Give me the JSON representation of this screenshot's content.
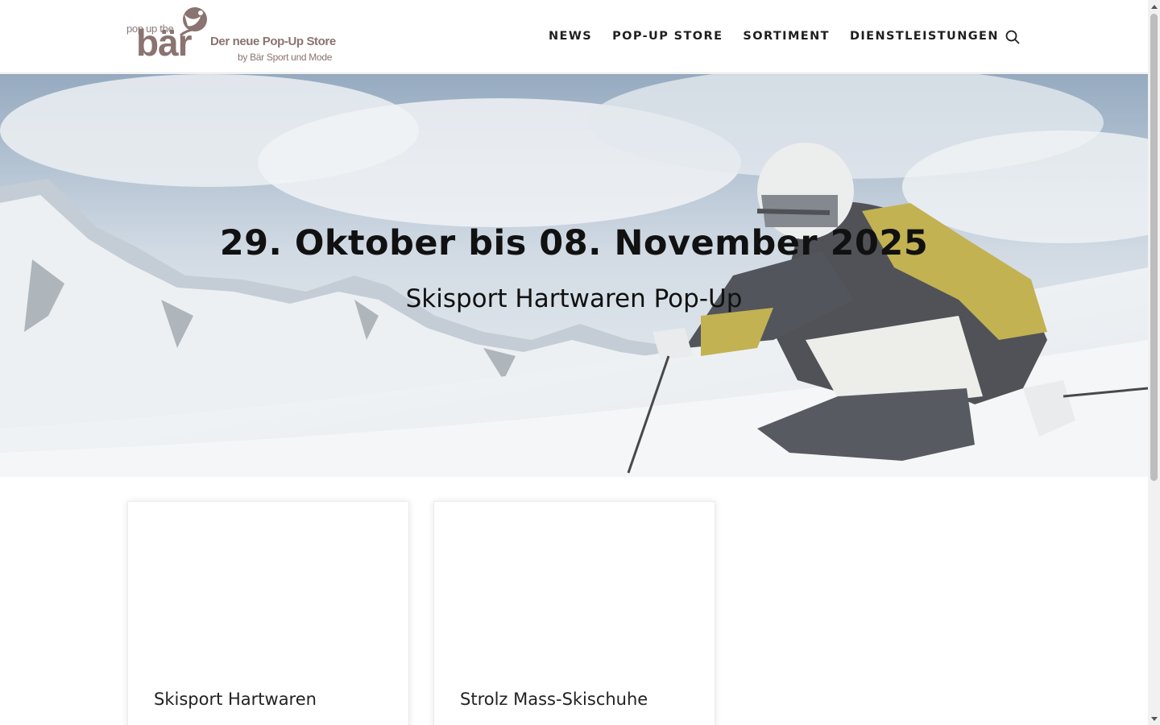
{
  "header": {
    "logo": {
      "small": "pop up the",
      "big": "bär",
      "tagline": "Der neue Pop-Up Store",
      "subline": "by Bär Sport und Mode"
    },
    "nav": [
      {
        "label": "NEWS"
      },
      {
        "label": "POP-UP STORE"
      },
      {
        "label": "SORTIMENT"
      },
      {
        "label": "DIENSTLEISTUNGEN"
      }
    ],
    "search_icon": "search-icon"
  },
  "hero": {
    "title": "29. Oktober bis 08. November 2025",
    "subtitle": "Skisport Hartwaren Pop-Up",
    "image": "skier-on-alpine-slope"
  },
  "cards": [
    {
      "title": "Skisport Hartwaren"
    },
    {
      "title": "Strolz Mass-Skischuhe"
    }
  ],
  "colors": {
    "brand": "#8a7370",
    "text": "#1f1f1f",
    "jacket_accent": "#b5a22c"
  }
}
